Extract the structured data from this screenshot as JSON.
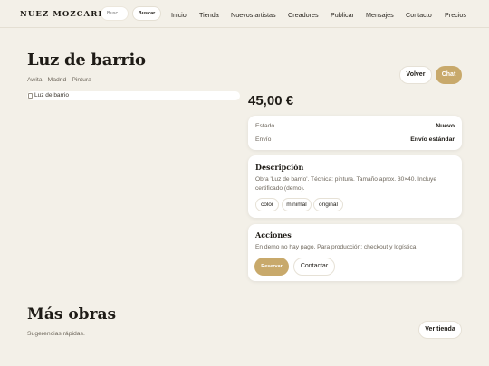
{
  "header": {
    "logo": "NUEZ MOZCARDA",
    "search_placeholder": "Busc",
    "search_button": "Buscar",
    "nav": [
      "Inicio",
      "Tienda",
      "Nuevos artistas",
      "Creadores",
      "Publicar",
      "Mensajes",
      "Contacto",
      "Precios"
    ]
  },
  "artwork": {
    "title": "Luz de barrio",
    "meta": "Awita · Madrid · Pintura",
    "image_alt": "Luz de barrio",
    "price": "45,00 €"
  },
  "actions_top": {
    "volver": "Volver",
    "chat": "Chat"
  },
  "details": {
    "estado_label": "Estado",
    "estado_value": "Nuevo",
    "envio_label": "Envío",
    "envio_value": "Envío estándar"
  },
  "descripcion": {
    "title": "Descripción",
    "text": "Obra 'Luz de barrio'. Técnica: pintura. Tamaño aprox. 30×40. Incluye certificado (demo).",
    "tags": [
      "color",
      "minimal",
      "original"
    ]
  },
  "acciones": {
    "title": "Acciones",
    "text": "En demo no hay pago. Para producción: checkout y logística.",
    "reservar": "Reservar",
    "contactar": "Contactar"
  },
  "more": {
    "title": "Más obras",
    "subtitle": "Sugerencias rápidas.",
    "ver_tienda": "Ver tienda"
  },
  "colors": {
    "background": "#f3f0e8",
    "accent_gold": "#c8a96b",
    "card": "#ffffff",
    "text": "#1e1b16"
  }
}
